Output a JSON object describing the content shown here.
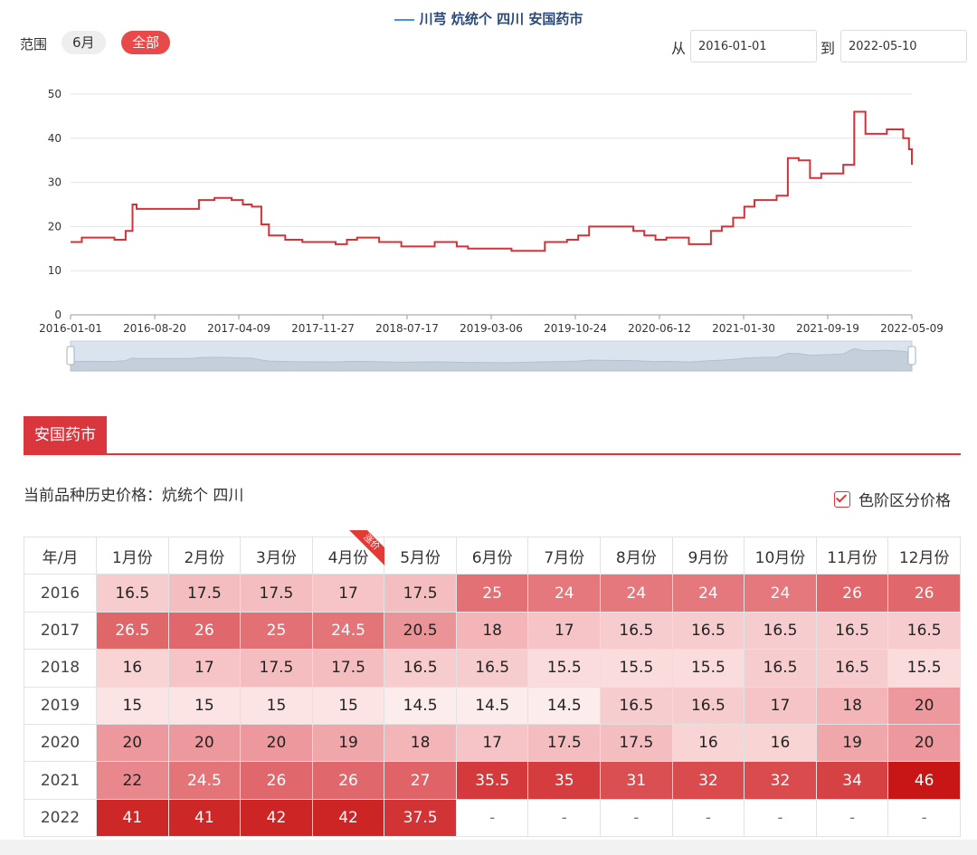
{
  "header": {
    "series_title": "川芎 炕统个 四川 安国药市",
    "range_label": "范围",
    "range_6m": "6月",
    "range_all": "全部",
    "from_label": "从",
    "from_value": "2016-01-01",
    "to_label": "到",
    "to_value": "2022-05-10"
  },
  "colors": {
    "line": "#d0343a",
    "accent": "#d9363e",
    "legend_line": "#4a90d9"
  },
  "chart_data": {
    "type": "line",
    "title": "",
    "xlabel": "",
    "ylabel": "",
    "ylim": [
      0,
      50
    ],
    "yticks": [
      0,
      10,
      20,
      30,
      40,
      50
    ],
    "x_range": [
      "2016-01-01",
      "2022-05-09"
    ],
    "x_tick_labels": [
      "2016-01-01",
      "2016-08-20",
      "2017-04-09",
      "2017-11-27",
      "2018-07-17",
      "2019-03-06",
      "2019-10-24",
      "2020-06-12",
      "2021-01-30",
      "2021-09-19",
      "2022-05-09"
    ],
    "grid": true,
    "series": [
      {
        "name": "川芎 炕统个 四川 安国药市",
        "points": [
          [
            "2016-01-01",
            16.5
          ],
          [
            "2016-02-01",
            17.5
          ],
          [
            "2016-05-01",
            17
          ],
          [
            "2016-06-01",
            19
          ],
          [
            "2016-06-20",
            25
          ],
          [
            "2016-07-01",
            24
          ],
          [
            "2016-12-01",
            24
          ],
          [
            "2016-12-20",
            26
          ],
          [
            "2017-02-01",
            26.5
          ],
          [
            "2017-03-20",
            26
          ],
          [
            "2017-04-20",
            25
          ],
          [
            "2017-05-15",
            24.5
          ],
          [
            "2017-06-10",
            20.5
          ],
          [
            "2017-07-01",
            18
          ],
          [
            "2017-08-15",
            17
          ],
          [
            "2017-10-01",
            16.5
          ],
          [
            "2018-01-01",
            16
          ],
          [
            "2018-02-01",
            17
          ],
          [
            "2018-03-01",
            17.5
          ],
          [
            "2018-05-01",
            16.5
          ],
          [
            "2018-07-01",
            15.5
          ],
          [
            "2018-10-01",
            16.5
          ],
          [
            "2018-12-01",
            15.5
          ],
          [
            "2019-01-01",
            15
          ],
          [
            "2019-05-01",
            14.5
          ],
          [
            "2019-08-01",
            16.5
          ],
          [
            "2019-10-01",
            17
          ],
          [
            "2019-11-01",
            18
          ],
          [
            "2019-12-01",
            20
          ],
          [
            "2020-04-01",
            19
          ],
          [
            "2020-05-01",
            18
          ],
          [
            "2020-06-01",
            17
          ],
          [
            "2020-07-01",
            17.5
          ],
          [
            "2020-09-01",
            16
          ],
          [
            "2020-11-01",
            19
          ],
          [
            "2020-12-01",
            20
          ],
          [
            "2021-01-01",
            22
          ],
          [
            "2021-02-01",
            24.5
          ],
          [
            "2021-03-01",
            26
          ],
          [
            "2021-05-01",
            27
          ],
          [
            "2021-06-01",
            35.5
          ],
          [
            "2021-07-01",
            35
          ],
          [
            "2021-08-01",
            31
          ],
          [
            "2021-09-01",
            32
          ],
          [
            "2021-11-01",
            34
          ],
          [
            "2021-12-01",
            46
          ],
          [
            "2022-01-01",
            41
          ],
          [
            "2022-03-01",
            42
          ],
          [
            "2022-04-15",
            40
          ],
          [
            "2022-05-01",
            37.5
          ],
          [
            "2022-05-09",
            34
          ]
        ]
      }
    ]
  },
  "tabs": [
    {
      "label": "安国药市"
    }
  ],
  "history": {
    "label": "当前品种历史价格：炕统个 四川",
    "color_scale_label": "色阶区分价格",
    "ribbon_text": "涨价"
  },
  "table": {
    "headers": [
      "年/月",
      "1月份",
      "2月份",
      "3月份",
      "4月份",
      "5月份",
      "6月份",
      "7月份",
      "8月份",
      "9月份",
      "10月份",
      "11月份",
      "12月份"
    ],
    "rows": [
      {
        "year": "2016",
        "values": [
          "16.5",
          "17.5",
          "17.5",
          "17",
          "17.5",
          "25",
          "24",
          "24",
          "24",
          "24",
          "26",
          "26"
        ]
      },
      {
        "year": "2017",
        "values": [
          "26.5",
          "26",
          "25",
          "24.5",
          "20.5",
          "18",
          "17",
          "16.5",
          "16.5",
          "16.5",
          "16.5",
          "16.5"
        ]
      },
      {
        "year": "2018",
        "values": [
          "16",
          "17",
          "17.5",
          "17.5",
          "16.5",
          "16.5",
          "15.5",
          "15.5",
          "15.5",
          "16.5",
          "16.5",
          "15.5"
        ]
      },
      {
        "year": "2019",
        "values": [
          "15",
          "15",
          "15",
          "15",
          "14.5",
          "14.5",
          "14.5",
          "16.5",
          "16.5",
          "17",
          "18",
          "20"
        ]
      },
      {
        "year": "2020",
        "values": [
          "20",
          "20",
          "20",
          "19",
          "18",
          "17",
          "17.5",
          "17.5",
          "16",
          "16",
          "19",
          "20"
        ]
      },
      {
        "year": "2021",
        "values": [
          "22",
          "24.5",
          "26",
          "26",
          "27",
          "35.5",
          "35",
          "31",
          "32",
          "32",
          "34",
          "46"
        ]
      },
      {
        "year": "2022",
        "values": [
          "41",
          "41",
          "42",
          "42",
          "37.5",
          "-",
          "-",
          "-",
          "-",
          "-",
          "-",
          "-"
        ]
      }
    ]
  }
}
